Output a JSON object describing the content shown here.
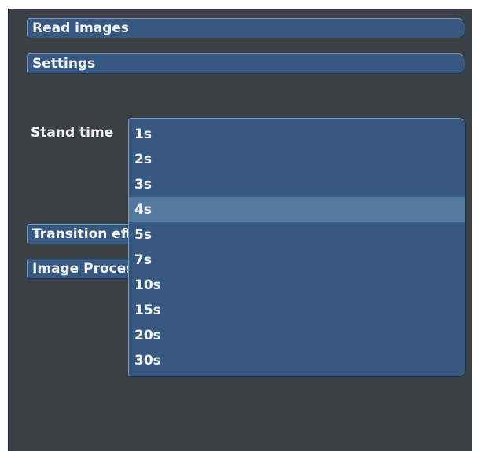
{
  "menu": {
    "read_images": "Read images",
    "settings": "Settings",
    "transition": "Transition effects",
    "image_processing": "Image Processing"
  },
  "stand_time": {
    "label": "Stand time",
    "selected": "4s",
    "options": [
      "1s",
      "2s",
      "3s",
      "4s",
      "5s",
      "7s",
      "10s",
      "15s",
      "20s",
      "30s"
    ]
  },
  "colors": {
    "panel_bg": "#3a4046",
    "button_bg": "#375981",
    "highlight": "#557a9f",
    "text": "#f3f5f8"
  }
}
